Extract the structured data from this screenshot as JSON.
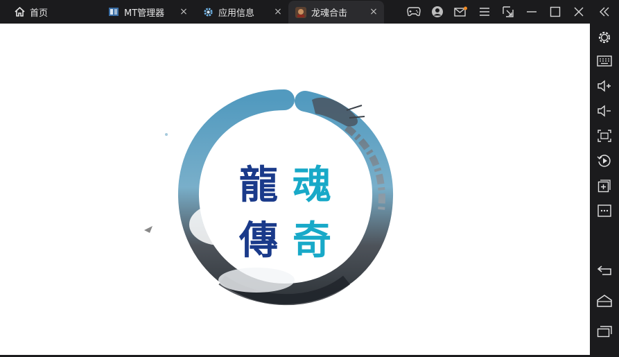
{
  "tabs": {
    "home": {
      "label": "首页"
    },
    "mt": {
      "label": "MT管理器"
    },
    "appinfo": {
      "label": "应用信息"
    },
    "game": {
      "label": "龙魂合击"
    }
  },
  "logo": {
    "chars": [
      "龍",
      "魂",
      "傳",
      "奇"
    ]
  },
  "icons": {
    "close": "×"
  },
  "colors": {
    "topbar": "#1b1b1d",
    "active_tab": "#2b2b2e",
    "notify_dot": "#f08a24",
    "logo_dark": "#1a3a8a",
    "logo_teal": "#18a9c8"
  }
}
